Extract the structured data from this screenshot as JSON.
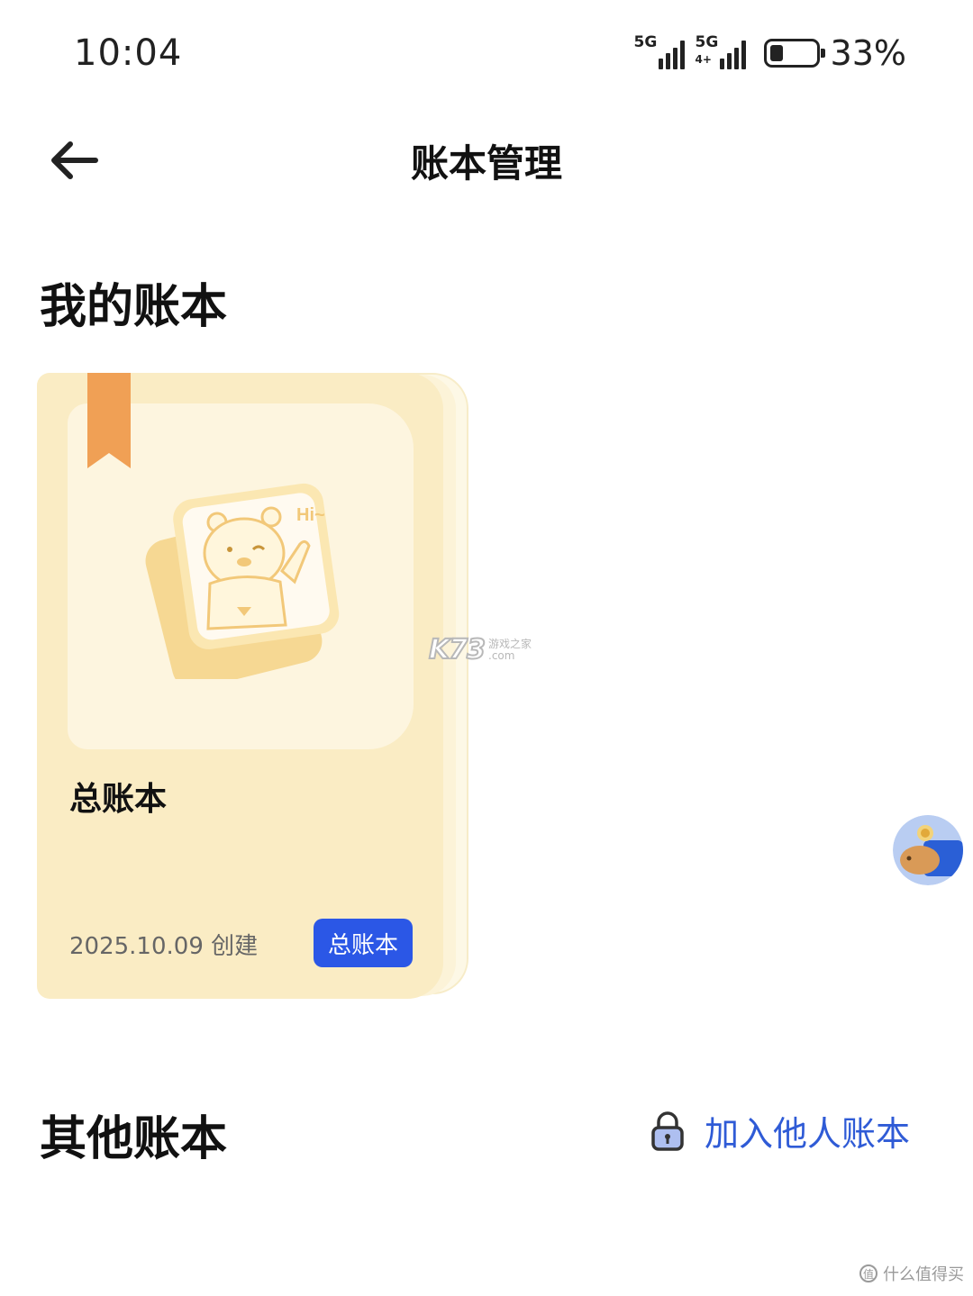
{
  "status_bar": {
    "time": "10:04",
    "signal_1": "5G",
    "signal_2": "5G",
    "signal_2_sub": "4+",
    "battery": "33%",
    "battery_level": 0.33
  },
  "header": {
    "title": "账本管理",
    "back_icon": "arrow-left-icon"
  },
  "my_ledgers": {
    "section_title": "我的账本",
    "items": [
      {
        "name": "总账本",
        "created": "2025.10.09 创建",
        "badge": "总账本",
        "ribbon_color": "#f0a055",
        "card_color": "#faecc4",
        "illustration": "bear-waving-hi-icon"
      }
    ]
  },
  "other_ledgers": {
    "section_title": "其他账本",
    "join_label": "加入他人账本",
    "join_icon": "lock-icon"
  },
  "watermarks": {
    "center_logo": "K73",
    "center_text_1": "游戏之家",
    "center_text_2": ".com",
    "corner_text": "什么值得买",
    "corner_icon": "值"
  },
  "colors": {
    "accent": "#2b57e6",
    "link": "#2f5bd6"
  }
}
